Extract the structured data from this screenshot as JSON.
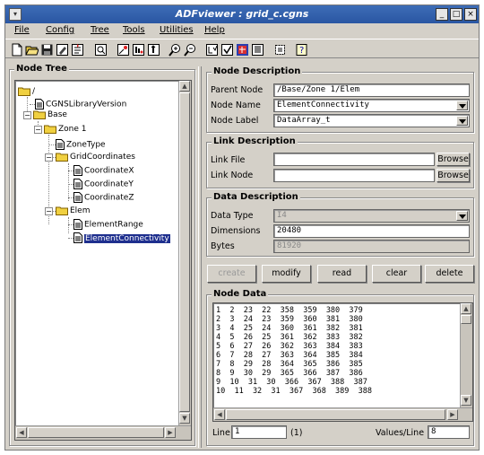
{
  "window": {
    "title": "ADFviewer : grid_c.cgns",
    "controls": [
      "_",
      "□",
      "×"
    ]
  },
  "menu": [
    "File",
    "Config",
    "Tree",
    "Tools",
    "Utilities",
    "Help"
  ],
  "toolbar_icons": [
    "new-file-icon",
    "open-folder-icon",
    "save-icon",
    "save-as-icon",
    "print-icon",
    "find-icon",
    "link-icon",
    "info-icon",
    "step-icon",
    "zoom-in-icon",
    "zoom-out-icon",
    "check-icon",
    "validate-icon",
    "color-icon",
    "list-icon",
    "settings-icon",
    "help-icon"
  ],
  "tree": {
    "title": "Node Tree",
    "nodes": [
      {
        "label": "/",
        "type": "folder",
        "depth": 0,
        "expanded": true
      },
      {
        "label": "CGNSLibraryVersion",
        "type": "leaf",
        "depth": 1
      },
      {
        "label": "Base",
        "type": "folder",
        "depth": 1,
        "expanded": true
      },
      {
        "label": "Zone  1",
        "type": "folder",
        "depth": 2,
        "expanded": true
      },
      {
        "label": "ZoneType",
        "type": "leaf",
        "depth": 3
      },
      {
        "label": "GridCoordinates",
        "type": "folder",
        "depth": 3,
        "expanded": true
      },
      {
        "label": "CoordinateX",
        "type": "leaf",
        "depth": 4
      },
      {
        "label": "CoordinateY",
        "type": "leaf",
        "depth": 4
      },
      {
        "label": "CoordinateZ",
        "type": "leaf",
        "depth": 4
      },
      {
        "label": "Elem",
        "type": "folder",
        "depth": 3,
        "expanded": true
      },
      {
        "label": "ElementRange",
        "type": "leaf",
        "depth": 4
      },
      {
        "label": "ElementConnectivity",
        "type": "leaf",
        "depth": 4,
        "selected": true
      }
    ]
  },
  "node_description": {
    "title": "Node Description",
    "parent_node_label": "Parent Node",
    "parent_node_value": "/Base/Zone  1/Elem",
    "node_name_label": "Node Name",
    "node_name_value": "ElementConnectivity",
    "node_label_label": "Node Label",
    "node_label_value": "DataArray_t"
  },
  "link_description": {
    "title": "Link Description",
    "link_file_label": "Link File",
    "link_node_label": "Link Node",
    "browse_label": "Browse"
  },
  "data_description": {
    "title": "Data Description",
    "data_type_label": "Data Type",
    "data_type_value": "I4",
    "dimensions_label": "Dimensions",
    "dimensions_value": "20480",
    "bytes_label": "Bytes",
    "bytes_value": "81920"
  },
  "actions": {
    "create": "create",
    "modify": "modify",
    "read": "read",
    "clear": "clear",
    "delete": "delete"
  },
  "node_data": {
    "title": "Node Data",
    "lines": [
      "1  2  23  22  358  359  380  379",
      "2  3  24  23  359  360  381  380",
      "3  4  25  24  360  361  382  381",
      "4  5  26  25  361  362  383  382",
      "5  6  27  26  362  363  384  383",
      "6  7  28  27  363  364  385  384",
      "7  8  29  28  364  365  386  385",
      "8  9  30  29  365  366  387  386",
      "9  10  31  30  366  367  388  387",
      "10  11  32  31  367  368  389  388"
    ],
    "line_label": "Line",
    "line_value": "1",
    "line_count": "(1)",
    "values_per_line_label": "Values/Line",
    "values_per_line_value": "8"
  }
}
